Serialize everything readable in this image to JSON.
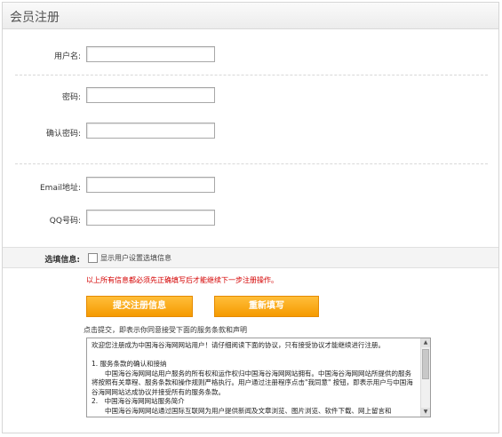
{
  "panel": {
    "title": "会员注册"
  },
  "form": {
    "username_label": "用户名:",
    "password_label": "密码:",
    "confirm_password_label": "确认密码:",
    "email_label": "Email地址:",
    "qq_label": "QQ号码:",
    "username_value": "",
    "password_value": "",
    "confirm_password_value": "",
    "email_value": "",
    "qq_value": ""
  },
  "optional": {
    "label": "选填信息:",
    "checkbox_text": "显示用户设置选填信息",
    "checked": false
  },
  "notice": "以上所有信息都必须先正确填写后才能继续下一步注册操作。",
  "buttons": {
    "submit_label": "提交注册信息",
    "reset_label": "重新填写"
  },
  "agree_hint": "点击提交，即表示你同意接受下面的服务条款和声明",
  "terms": {
    "text": "欢迎您注册成为中国海谷海网网站用户！请仔细阅读下面的协议，只有接受协议才能继续进行注册。\n\n1. 服务条款的确认和接纳\n　　中国海谷海网网站用户服务的所有权和运作权归中国海谷海网网站拥有。中国海谷海网网站所提供的服务将按照有关章程、服务条款和操作规则严格执行。用户通过注册程序点击\"我同意\" 按钮，即表示用户与中国海谷海网网站达成协议并接受所有的服务条款。\n2.　中国海谷海网网站服务简介\n　　中国海谷海网网站通过国际互联网为用户提供新闻及文章浏览、图片浏览、软件下载、网上留言和"
  },
  "icons": {
    "scroll_up": "scroll-up-arrow-icon",
    "scroll_down": "scroll-down-arrow-icon"
  },
  "colors": {
    "button_orange": "#f7a21a",
    "notice_red": "#d40000"
  }
}
